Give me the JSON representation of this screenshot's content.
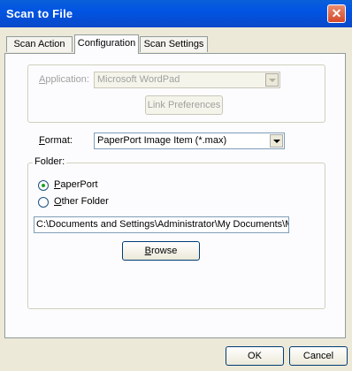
{
  "window": {
    "title": "Scan to File"
  },
  "tabs": [
    "Scan Action",
    "Configuration",
    "Scan Settings"
  ],
  "application": {
    "label": "Application:",
    "value": "Microsoft WordPad",
    "link_preferences": "Link Preferences"
  },
  "format": {
    "label": "Format:",
    "value": "PaperPort Image Item (*.max)"
  },
  "folder": {
    "legend": "Folder:",
    "option_paperport": "PaperPort",
    "option_other": "Other Folder",
    "path": "C:\\Documents and Settings\\Administrator\\My Documents\\M",
    "browse": "Browse"
  },
  "buttons": {
    "ok": "OK",
    "cancel": "Cancel"
  }
}
